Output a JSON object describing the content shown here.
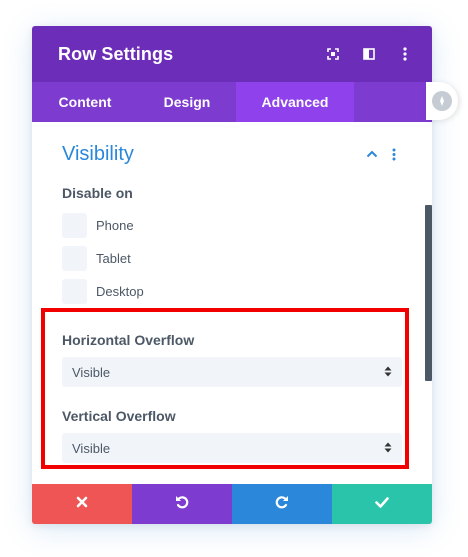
{
  "modal": {
    "title": "Row Settings",
    "header_icons": [
      "fullscreen-icon",
      "sidebar-toggle-icon",
      "more-vertical-icon"
    ]
  },
  "tabs": [
    {
      "label": "Content",
      "active": false
    },
    {
      "label": "Design",
      "active": false
    },
    {
      "label": "Advanced",
      "active": true
    }
  ],
  "section": {
    "title": "Visibility",
    "disable_on": {
      "label": "Disable on",
      "options": [
        {
          "label": "Phone",
          "checked": false
        },
        {
          "label": "Tablet",
          "checked": false
        },
        {
          "label": "Desktop",
          "checked": false
        }
      ]
    },
    "horizontal_overflow": {
      "label": "Horizontal Overflow",
      "value": "Visible"
    },
    "vertical_overflow": {
      "label": "Vertical Overflow",
      "value": "Visible"
    }
  },
  "footer": {
    "buttons": [
      "close-icon",
      "undo-icon",
      "redo-icon",
      "check-icon"
    ]
  },
  "colors": {
    "header": "#6c2eb9",
    "tabs": "#7e3bd0",
    "active_tab": "#8f42ec",
    "section_title": "#2b87da",
    "cancel": "#ef5555",
    "undo": "#7e3bd0",
    "redo": "#2b87da",
    "save": "#29c4a9",
    "highlight_box": "#f20000"
  }
}
